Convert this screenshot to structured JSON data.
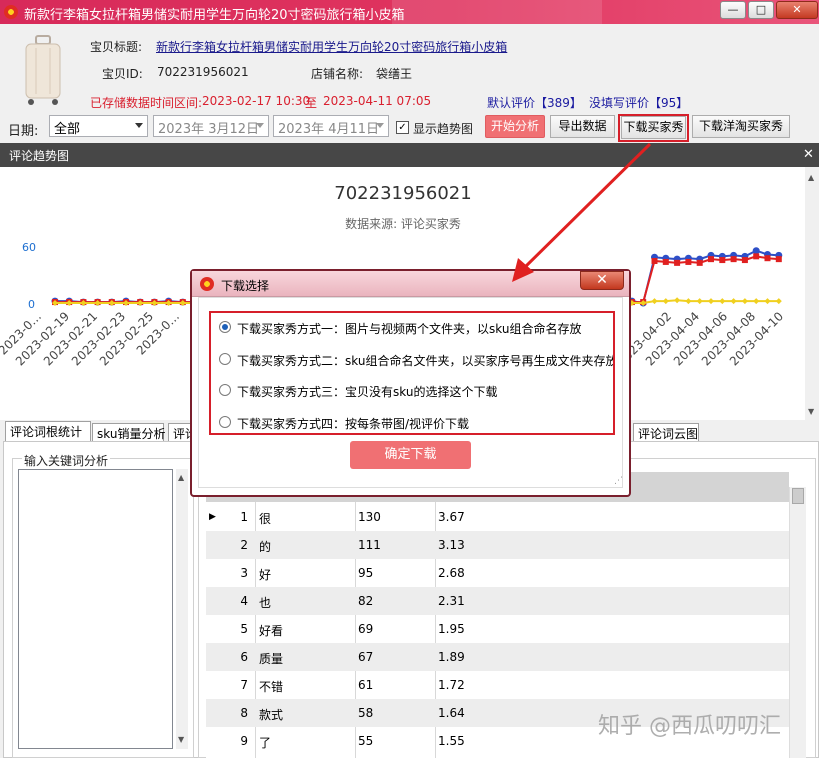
{
  "window": {
    "title": "新款行李箱女拉杆箱男储实耐用学生万向轮20寸密码旅行箱小皮箱",
    "controls": {
      "minimize": "—",
      "maximize": "□",
      "close": "✕"
    },
    "close_color": "#c43a22"
  },
  "header": {
    "item_title_label": "宝贝标题:",
    "item_title": "新款行李箱女拉杆箱男储实耐用学生万向轮20寸密码旅行箱小皮箱",
    "item_id_label": "宝贝ID:",
    "item_id": "702231956021",
    "shop_label": "店铺名称:",
    "shop_name": "袋缮王",
    "range_label": "已存储数据时间区间:",
    "range_start": "2023-02-17 10:30",
    "range_to": "至",
    "range_end": "2023-04-11 07:05",
    "default_review_label": "默认评价【389】",
    "no_text_review_label": "没填写评价【95】"
  },
  "toolbar": {
    "date_label": "日期:",
    "date_select": "全部",
    "date_from": "2023年 3月12日",
    "date_to": "2023年 4月11日",
    "show_trend_label": "显示趋势图",
    "show_trend_checked": "✓",
    "start_button": "开始分析",
    "export_button": "导出数据",
    "download_buyer_show": "下载买家秀",
    "download_taobao_show": "下载洋淘买家秀"
  },
  "trend": {
    "header": "评论趋势图",
    "close": "✕"
  },
  "chart_data": {
    "type": "line",
    "title": "702231956021",
    "subtitle": "数据来源: 评论买家秀",
    "y_ticks": [
      "60",
      "0"
    ],
    "ylim": [
      0,
      60
    ],
    "x_ticks_visible": [
      "2023-0…",
      "2023-02-19",
      "2023-02-21",
      "2023-02-23",
      "2023-02-25",
      "2023-0…",
      "2023-04-02",
      "2023-04-04",
      "2023-04-06",
      "2023-04-08",
      "2023-04-10"
    ],
    "series": [
      {
        "color": "#2e4fc7",
        "left_values": [
          2,
          2,
          1,
          1,
          1,
          2,
          1,
          1,
          2,
          1,
          1,
          1,
          1,
          1,
          2
        ],
        "right_values": [
          2,
          2,
          1,
          2,
          0,
          49,
          48,
          47,
          48,
          47,
          51,
          50,
          51,
          50,
          56,
          52,
          51
        ]
      },
      {
        "color": "#e02020",
        "left_values": [
          1,
          1,
          1,
          1,
          1,
          1,
          1,
          1,
          1,
          1,
          1,
          1,
          1,
          1,
          1
        ],
        "right_values": [
          1,
          1,
          1,
          1,
          1,
          45,
          44,
          43,
          44,
          43,
          47,
          46,
          47,
          46,
          50,
          48,
          47
        ]
      },
      {
        "color": "#f0d020",
        "left_values": [
          0,
          0,
          0,
          0,
          0,
          0,
          0,
          0,
          0,
          0,
          0,
          0,
          0,
          0,
          0
        ],
        "right_values": [
          0,
          0,
          0,
          0,
          0,
          2,
          2,
          3,
          2,
          2,
          2,
          2,
          2,
          2,
          2,
          2,
          2
        ]
      }
    ]
  },
  "tabs": [
    "评论词根统计",
    "sku销量分析",
    "评论",
    "评论词云图"
  ],
  "lower": {
    "keyword_group_label": "输入关键词分析",
    "rows": [
      {
        "no": "1",
        "word": "很",
        "count": "130",
        "pct": "3.67",
        "marker": "▶"
      },
      {
        "no": "2",
        "word": "的",
        "count": "111",
        "pct": "3.13"
      },
      {
        "no": "3",
        "word": "好",
        "count": "95",
        "pct": "2.68"
      },
      {
        "no": "4",
        "word": "也",
        "count": "82",
        "pct": "2.31"
      },
      {
        "no": "5",
        "word": "好看",
        "count": "69",
        "pct": "1.95"
      },
      {
        "no": "6",
        "word": "质量",
        "count": "67",
        "pct": "1.89"
      },
      {
        "no": "7",
        "word": "不错",
        "count": "61",
        "pct": "1.72"
      },
      {
        "no": "8",
        "word": "款式",
        "count": "58",
        "pct": "1.64"
      },
      {
        "no": "9",
        "word": "了",
        "count": "55",
        "pct": "1.55"
      }
    ]
  },
  "dialog": {
    "title": "下载选择",
    "close": "✕",
    "options": [
      "下载买家秀方式一：图片与视频两个文件夹，以sku组合命名存放",
      "下载买家秀方式二：sku组合命名文件夹，以买家序号再生成文件夹存放",
      "下载买家秀方式三：宝贝没有sku的选择这个下载",
      "下载买家秀方式四：按每条带图/视评价下载"
    ],
    "confirm": "确定下载"
  },
  "watermark": "知乎 @西瓜叨叨汇"
}
